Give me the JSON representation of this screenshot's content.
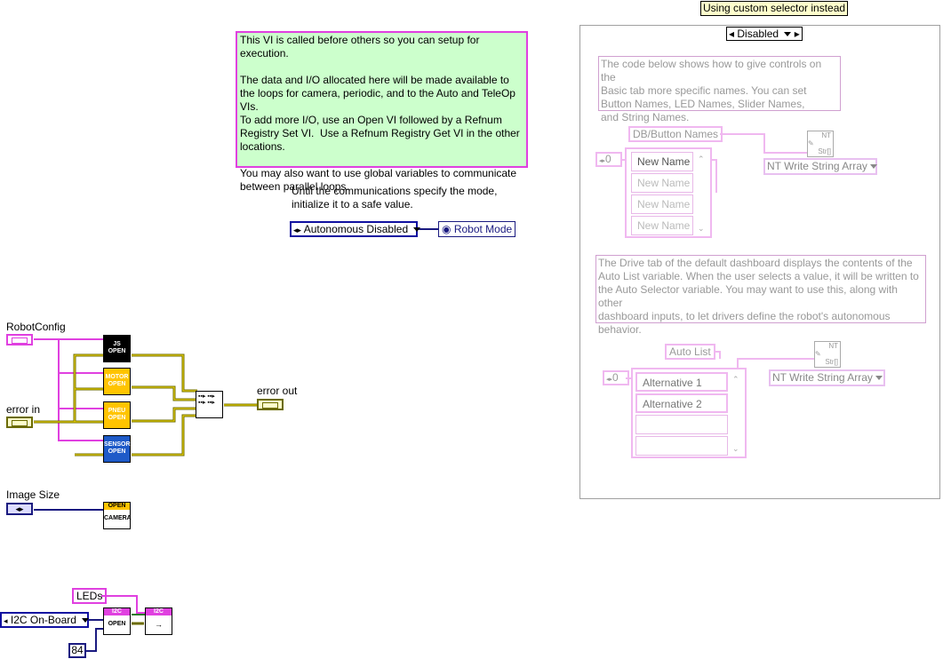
{
  "top_tag": "Using custom selector instead",
  "selector": {
    "value": "Disabled"
  },
  "note_main": "This VI is called before others so you can setup for execution.\n\nThe data and I/O allocated here will be made available to the loops for camera, periodic, and to the Auto and TeleOp VIs.\nTo add more I/O, use an Open VI followed by a Refnum Registry Set VI.  Use a Refnum Registry Get VI in the other locations.\n\nYou may also want to use global variables to communicate between parallel loops.",
  "mode_note": "Until the communications specify the mode,\ninitialize it to a safe value.",
  "mode_enum": "Autonomous Disabled",
  "robot_mode": "Robot Mode",
  "robot_config": "RobotConfig",
  "error_in": "error in",
  "error_out": "error out",
  "subvis": {
    "js": [
      "JS",
      "OPEN"
    ],
    "motor": [
      "MOTOR",
      "OPEN"
    ],
    "pneu": [
      "PNEU",
      "OPEN"
    ],
    "sensor": [
      "SENSOR",
      "OPEN"
    ],
    "camera": [
      "OPEN",
      "CAMERA"
    ],
    "i2c_open": [
      "I2C",
      "OPEN"
    ],
    "i2c_write": [
      "I2C",
      "→"
    ]
  },
  "image_size": "Image Size",
  "leds": "LEDs",
  "i2c_enum": "I2C On-Board",
  "i2c_addr": "84",
  "panel_note1": "The code below shows how to give controls on the\nBasic tab more specific names. You can set\nButton Names, LED Names, Slider Names,\nand String Names.",
  "db_button_names": "DB/Button Names",
  "index1": "0",
  "new_name_items": [
    "New Name",
    "New Name",
    "New Name",
    "New Name"
  ],
  "nt_label": "NT",
  "str_label": "Str[]",
  "nt_write": "NT Write String Array",
  "panel_note2": "The Drive tab of the default dashboard displays the contents of the\nAuto List variable. When the user selects a value, it will be written to\nthe Auto Selector variable. You may want to use this, along with other\ndashboard inputs, to let drivers define the robot's autonomous\nbehavior.",
  "auto_list": "Auto List",
  "index2": "0",
  "alternatives": [
    "Alternative 1",
    "Alternative 2",
    "",
    ""
  ],
  "nt_write2": "NT Write String Array"
}
